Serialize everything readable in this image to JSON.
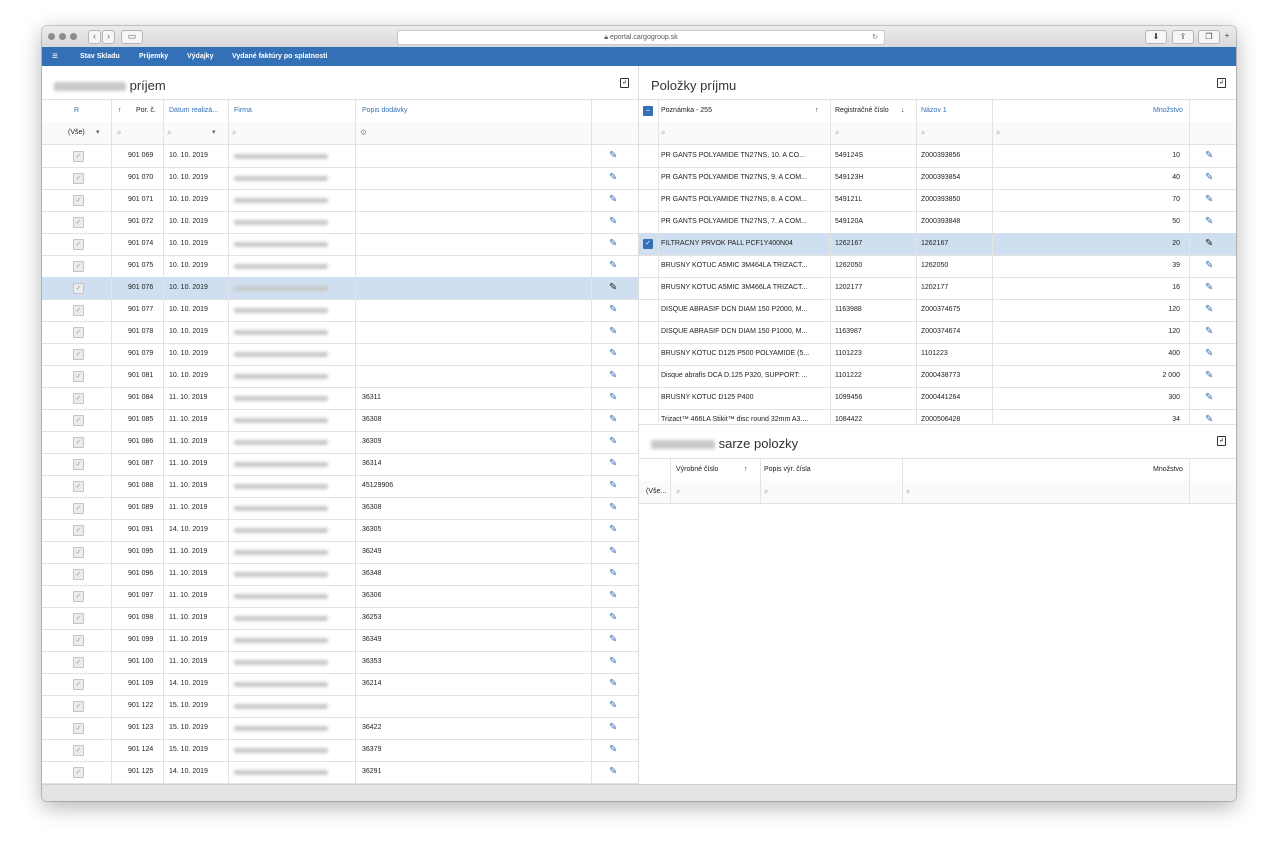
{
  "browser": {
    "url": "eportal.cargogroup.sk"
  },
  "menu": {
    "items": [
      "Stav Skladu",
      "Príjemky",
      "Výdajky",
      "Vydané faktúry po splatnosti"
    ]
  },
  "left": {
    "title": "príjem",
    "columns": [
      "R",
      "Por. č.",
      "Dátum realizá...",
      "Firma",
      "Popis dodávky"
    ],
    "filter_all": "(Vše)",
    "rows": [
      {
        "por": "901 069",
        "date": "10. 10. 2019",
        "popis": ""
      },
      {
        "por": "901 070",
        "date": "10. 10. 2019",
        "popis": ""
      },
      {
        "por": "901 071",
        "date": "10. 10. 2019",
        "popis": ""
      },
      {
        "por": "901 072",
        "date": "10. 10. 2019",
        "popis": ""
      },
      {
        "por": "901 074",
        "date": "10. 10. 2019",
        "popis": ""
      },
      {
        "por": "901 075",
        "date": "10. 10. 2019",
        "popis": ""
      },
      {
        "por": "901 076",
        "date": "10. 10. 2019",
        "popis": "",
        "selected": true
      },
      {
        "por": "901 077",
        "date": "10. 10. 2019",
        "popis": ""
      },
      {
        "por": "901 078",
        "date": "10. 10. 2019",
        "popis": ""
      },
      {
        "por": "901 079",
        "date": "10. 10. 2019",
        "popis": ""
      },
      {
        "por": "901 081",
        "date": "10. 10. 2019",
        "popis": ""
      },
      {
        "por": "901 084",
        "date": "11. 10. 2019",
        "popis": "36311"
      },
      {
        "por": "901 085",
        "date": "11. 10. 2019",
        "popis": "36308"
      },
      {
        "por": "901 086",
        "date": "11. 10. 2019",
        "popis": "36309"
      },
      {
        "por": "901 087",
        "date": "11. 10. 2019",
        "popis": "36314"
      },
      {
        "por": "901 088",
        "date": "11. 10. 2019",
        "popis": "45129906"
      },
      {
        "por": "901 089",
        "date": "11. 10. 2019",
        "popis": "36308"
      },
      {
        "por": "901 091",
        "date": "14. 10. 2019",
        "popis": "36305"
      },
      {
        "por": "901 095",
        "date": "11. 10. 2019",
        "popis": "36249"
      },
      {
        "por": "901 096",
        "date": "11. 10. 2019",
        "popis": "36348"
      },
      {
        "por": "901 097",
        "date": "11. 10. 2019",
        "popis": "36306"
      },
      {
        "por": "901 098",
        "date": "11. 10. 2019",
        "popis": "36253"
      },
      {
        "por": "901 099",
        "date": "11. 10. 2019",
        "popis": "36349"
      },
      {
        "por": "901 100",
        "date": "11. 10. 2019",
        "popis": "36353"
      },
      {
        "por": "901 109",
        "date": "14. 10. 2019",
        "popis": "36214"
      },
      {
        "por": "901 122",
        "date": "15. 10. 2019",
        "popis": ""
      },
      {
        "por": "901 123",
        "date": "15. 10. 2019",
        "popis": "36422"
      },
      {
        "por": "901 124",
        "date": "15. 10. 2019",
        "popis": "36379"
      },
      {
        "por": "901 125",
        "date": "14. 10. 2019",
        "popis": "36291"
      }
    ]
  },
  "right_top": {
    "title": "Položky príjmu",
    "columns": [
      "Poznámka - 255",
      "Registračné číslo",
      "Názov 1",
      "Množstvo"
    ],
    "rows": [
      {
        "poznamka": "PR GANTS POLYAMIDE TN27NS, 10. A CO...",
        "reg": "549124S",
        "nazov": "Z000393856",
        "mnozstvo": "10"
      },
      {
        "poznamka": "PR GANTS POLYAMIDE TN27NS, 9. A COM...",
        "reg": "549123H",
        "nazov": "Z000393854",
        "mnozstvo": "40"
      },
      {
        "poznamka": "PR GANTS POLYAMIDE TN27NS, 8. A COM...",
        "reg": "549121L",
        "nazov": "Z000393850",
        "mnozstvo": "70"
      },
      {
        "poznamka": "PR GANTS POLYAMIDE TN27NS, 7. A COM...",
        "reg": "549120A",
        "nazov": "Z000393848",
        "mnozstvo": "50"
      },
      {
        "poznamka": "FILTRACNY PRVOK PALL PCF1Y400N04",
        "reg": "1262167",
        "nazov": "1262167",
        "mnozstvo": "20",
        "selected": true
      },
      {
        "poznamka": "BRUSNY KOTUC A5MIC 3M464LA TRIZACT...",
        "reg": "1262050",
        "nazov": "1262050",
        "mnozstvo": "39"
      },
      {
        "poznamka": "BRUSNY KOTUC A5MIC 3M466LA TRIZACT...",
        "reg": "1202177",
        "nazov": "1202177",
        "mnozstvo": "16"
      },
      {
        "poznamka": "DISQUE ABRASIF DCN DIAM 150 P2000, M...",
        "reg": "1163988",
        "nazov": "Z000374675",
        "mnozstvo": "120"
      },
      {
        "poznamka": "DISQUE ABRASIF DCN DIAM 150 P1000, M...",
        "reg": "1163987",
        "nazov": "Z000374674",
        "mnozstvo": "120"
      },
      {
        "poznamka": "BRUSNY KOTUC D125 P500 POLYAMIDE (5...",
        "reg": "1101223",
        "nazov": "1101223",
        "mnozstvo": "400"
      },
      {
        "poznamka": "Disque abrafis DCA D.125 P320, SUPPORT: ...",
        "reg": "1101222",
        "nazov": "Z000438773",
        "mnozstvo": "2 000"
      },
      {
        "poznamka": "BRUSNY KOTUC D125 P400",
        "reg": "1099456",
        "nazov": "Z000441264",
        "mnozstvo": "300"
      },
      {
        "poznamka": "Trizact™ 466LA Stikit™ disc round 32mm A3....",
        "reg": "1084422",
        "nazov": "Z000506428",
        "mnozstvo": "34"
      }
    ]
  },
  "right_bottom": {
    "title": "sarze polozky",
    "columns": [
      "Výrobné číslo",
      "Popis výr. čísla",
      "Množstvo"
    ],
    "filter_all": "(Vše..."
  },
  "colors": {
    "accent": "#3470b6",
    "selected_row": "#cfdfef"
  }
}
